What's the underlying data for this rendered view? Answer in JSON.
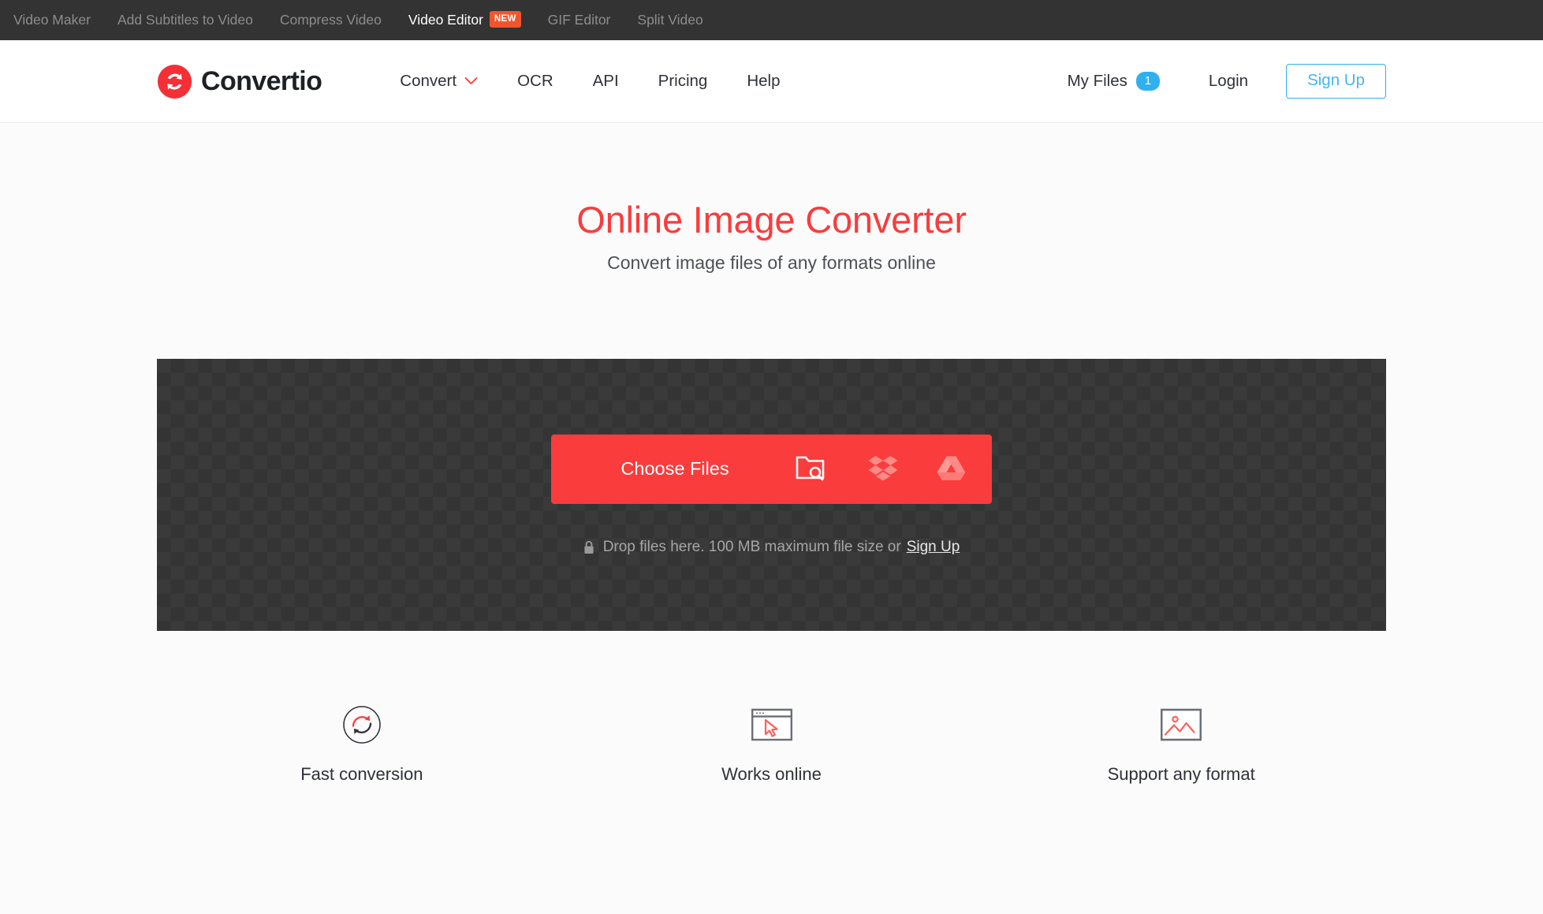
{
  "topbar": {
    "links": [
      {
        "label": "Video Maker",
        "active": false,
        "badge": null
      },
      {
        "label": "Add Subtitles to Video",
        "active": false,
        "badge": null
      },
      {
        "label": "Compress Video",
        "active": false,
        "badge": null
      },
      {
        "label": "Video Editor",
        "active": true,
        "badge": "NEW"
      },
      {
        "label": "GIF Editor",
        "active": false,
        "badge": null
      },
      {
        "label": "Split Video",
        "active": false,
        "badge": null
      }
    ]
  },
  "header": {
    "logo_text": "Convertio",
    "logo_icon": "convert-circular-arrows-icon",
    "nav": [
      {
        "label": "Convert",
        "has_caret": true
      },
      {
        "label": "OCR",
        "has_caret": false
      },
      {
        "label": "API",
        "has_caret": false
      },
      {
        "label": "Pricing",
        "has_caret": false
      },
      {
        "label": "Help",
        "has_caret": false
      }
    ],
    "my_files_label": "My Files",
    "my_files_count": "1",
    "login_label": "Login",
    "signup_label": "Sign Up"
  },
  "hero": {
    "title": "Online Image Converter",
    "subtitle": "Convert image files of any formats online"
  },
  "dropzone": {
    "choose_files_label": "Choose Files",
    "sources": [
      {
        "name": "folder-search-icon",
        "title": "From Computer"
      },
      {
        "name": "dropbox-icon",
        "title": "From Dropbox"
      },
      {
        "name": "google-drive-icon",
        "title": "From Google Drive"
      }
    ],
    "hint_lock_icon": "lock-icon",
    "hint_text": "Drop files here. 100 MB maximum file size or",
    "hint_link": "Sign Up"
  },
  "features": [
    {
      "icon": "refresh-circle-icon",
      "label": "Fast conversion"
    },
    {
      "icon": "browser-cursor-icon",
      "label": "Works online"
    },
    {
      "icon": "image-picture-icon",
      "label": "Support any format"
    }
  ],
  "colors": {
    "brand_red": "#fa3c3c",
    "accent_blue": "#31b0ef",
    "badge_orange": "#f2552c",
    "dark_bar": "#333333",
    "dropzone_dark": "#3a3a3a"
  }
}
